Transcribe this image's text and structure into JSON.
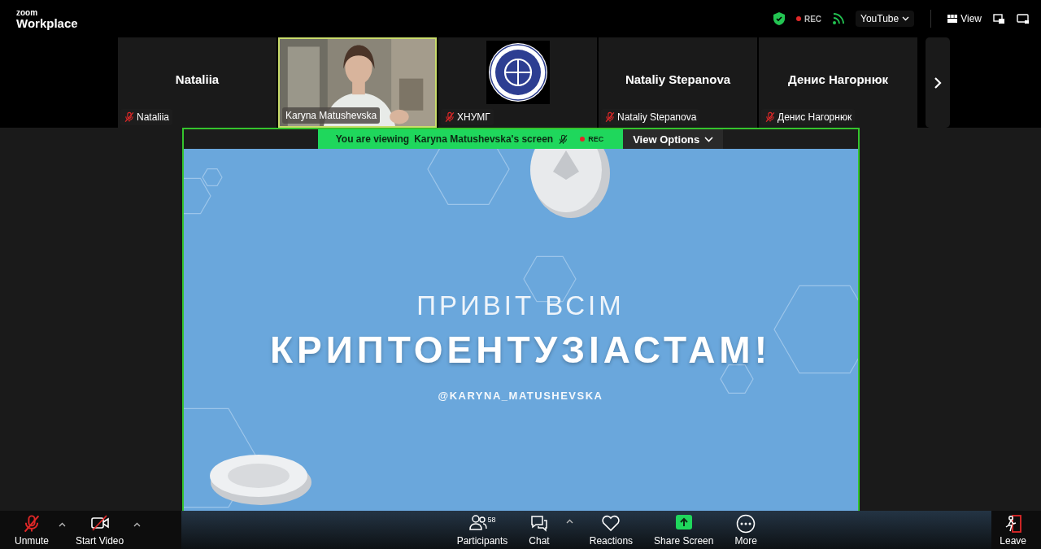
{
  "brand": {
    "line1": "zoom",
    "line2": "Workplace"
  },
  "top_bar": {
    "secure": true,
    "rec": "REC",
    "stream": "YouTube",
    "view": "View"
  },
  "tiles": [
    {
      "kind": "name",
      "title": "Nataliia",
      "label": "Nataliia",
      "muted": true,
      "selected": false
    },
    {
      "kind": "video",
      "label": "Karyna Matushevska",
      "muted": false,
      "selected": true
    },
    {
      "kind": "logo",
      "label": "ХНУМГ",
      "muted": true,
      "selected": false
    },
    {
      "kind": "name",
      "title": "Nataliy Stepanova",
      "label": "Nataliy Stepanova",
      "muted": true,
      "selected": false
    },
    {
      "kind": "name",
      "title": "Денис Нагорнюк",
      "label": "Денис Нагорнюк",
      "muted": true,
      "selected": false
    }
  ],
  "share_banner": {
    "prefix": "You are viewing",
    "sharer": "Karyna Matushevska's screen",
    "rec": "REC",
    "view_options": "View Options"
  },
  "slide": {
    "line1": "ПРИВІТ ВСІМ",
    "line2": "КРИПТОЕНТУЗІАСТАМ!",
    "handle": "@KARYNA_MATUSHEVSKA"
  },
  "toolbar": {
    "left": [
      {
        "kind": "mic",
        "label": "Unmute",
        "muted": true
      },
      {
        "kind": "video",
        "label": "Start Video",
        "muted": true
      }
    ],
    "center": [
      {
        "kind": "participants",
        "label": "Participants",
        "count": "58"
      },
      {
        "kind": "chat",
        "label": "Chat"
      },
      {
        "kind": "reactions",
        "label": "Reactions"
      },
      {
        "kind": "share",
        "label": "Share Screen"
      },
      {
        "kind": "more",
        "label": "More"
      }
    ],
    "leave": "Leave"
  }
}
